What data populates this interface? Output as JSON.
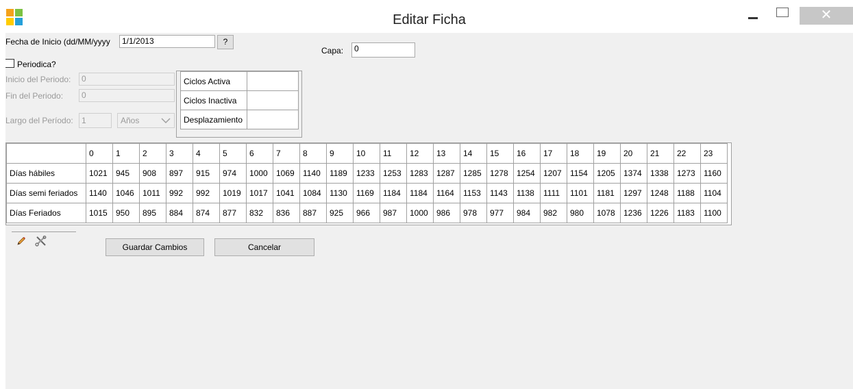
{
  "window": {
    "title": "Editar Ficha"
  },
  "form": {
    "fecha_label": "Fecha de Inicio (dd/MM/yyyy",
    "fecha_value": "1/1/2013",
    "help_button": "?",
    "capa_label": "Capa:",
    "capa_value": "0",
    "periodica_label": "Periodica?",
    "inicio_label": "Inicio del Periodo:",
    "inicio_value": "0",
    "fin_label": "Fin del Periodo:",
    "fin_value": "0",
    "largo_label": "Largo del Período:",
    "largo_value": "1",
    "unidad_value": "Años"
  },
  "cycles": [
    {
      "label": "Ciclos Activa",
      "value": ""
    },
    {
      "label": "Ciclos Inactiva",
      "value": ""
    },
    {
      "label": "Desplazamiento",
      "value": ""
    }
  ],
  "grid": {
    "columns": [
      "0",
      "1",
      "2",
      "3",
      "4",
      "5",
      "6",
      "7",
      "8",
      "9",
      "10",
      "11",
      "12",
      "13",
      "14",
      "15",
      "16",
      "17",
      "18",
      "19",
      "20",
      "21",
      "22",
      "23"
    ],
    "rows": [
      {
        "label": "Días hábiles",
        "values": [
          "1021",
          "945",
          "908",
          "897",
          "915",
          "974",
          "1000",
          "1069",
          "1140",
          "1189",
          "1233",
          "1253",
          "1283",
          "1287",
          "1285",
          "1278",
          "1254",
          "1207",
          "1154",
          "1205",
          "1374",
          "1338",
          "1273",
          "1160"
        ]
      },
      {
        "label": "Días semi feriados",
        "values": [
          "1140",
          "1046",
          "1011",
          "992",
          "992",
          "1019",
          "1017",
          "1041",
          "1084",
          "1130",
          "1169",
          "1184",
          "1184",
          "1164",
          "1153",
          "1143",
          "1138",
          "1111",
          "1101",
          "1181",
          "1297",
          "1248",
          "1188",
          "1104"
        ]
      },
      {
        "label": "Días Feriados",
        "values": [
          "1015",
          "950",
          "895",
          "884",
          "874",
          "877",
          "832",
          "836",
          "887",
          "925",
          "966",
          "987",
          "1000",
          "986",
          "978",
          "977",
          "984",
          "982",
          "980",
          "1078",
          "1236",
          "1226",
          "1183",
          "1100"
        ]
      }
    ]
  },
  "buttons": {
    "save": "Guardar Cambios",
    "cancel": "Cancelar"
  },
  "colors": {
    "icon_orange": "#f4a21a",
    "icon_green": "#7cc242",
    "icon_yellow": "#ffcc00",
    "icon_blue": "#25a0da"
  }
}
